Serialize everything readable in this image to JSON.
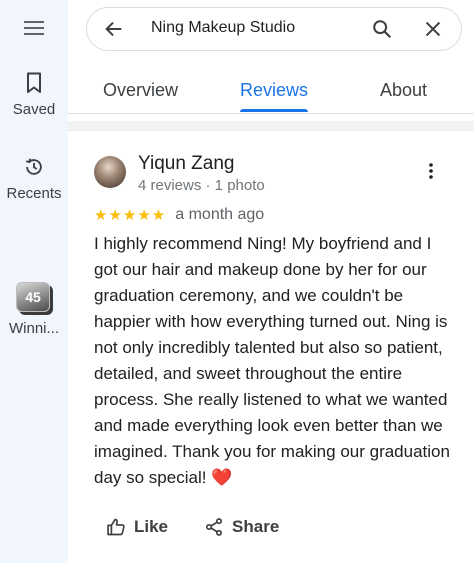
{
  "rail": {
    "saved_label": "Saved",
    "recents_label": "Recents",
    "recent_place": {
      "badge": "45",
      "label": "Winni..."
    }
  },
  "search": {
    "query": "Ning Makeup Studio"
  },
  "tabs": [
    {
      "label": "Overview",
      "active": false
    },
    {
      "label": "Reviews",
      "active": true
    },
    {
      "label": "About",
      "active": false
    }
  ],
  "review": {
    "author": "Yiqun Zang",
    "meta": "4 reviews · 1 photo",
    "rating": 5,
    "stars_text": "★★★★★",
    "date": "a month ago",
    "text": "I highly recommend Ning! My boyfriend and I got our hair and makeup done by her for our graduation ceremony, and we couldn't be happier with how everything turned out. Ning is not only incredibly talented but also so patient, detailed, and sweet throughout the entire process. She really listened to what we wanted and made everything look even better than we imagined. Thank you for making our graduation day so special! ❤️",
    "like_label": "Like",
    "share_label": "Share"
  },
  "colors": {
    "accent": "#1a73e8",
    "star": "#fbbc04",
    "rail_bg": "#f1f5fc"
  }
}
